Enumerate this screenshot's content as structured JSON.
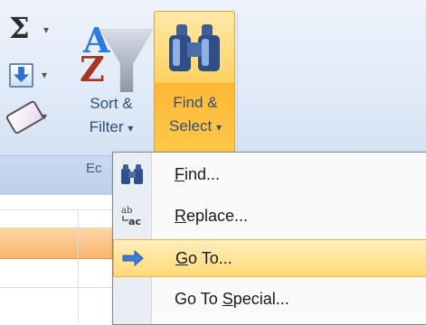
{
  "ribbon": {
    "sort_filter": {
      "line1": "Sort &",
      "line2": "Filter",
      "arrow": "▾"
    },
    "find_select": {
      "line1": "Find &",
      "line2": "Select",
      "arrow": "▾"
    },
    "group_label": "Ec",
    "icons": [
      "autosum-icon",
      "fill-icon",
      "clear-icon",
      "sort-filter-icon",
      "binoculars-icon"
    ],
    "accent": "#ffc84a"
  },
  "menu": {
    "items": [
      {
        "name": "find",
        "icon": "binoculars-icon",
        "mnemonic": "F",
        "rest": "ind..."
      },
      {
        "name": "replace",
        "icon": "replace-icon",
        "mnemonic": "R",
        "rest": "eplace..."
      },
      {
        "name": "go-to",
        "icon": "arrow-right-icon",
        "mnemonic": "G",
        "rest": "o To...",
        "highlighted": true
      },
      {
        "name": "go-to-special",
        "icon": "none",
        "prefix": "Go To ",
        "mnemonic": "S",
        "rest": "pecial..."
      }
    ]
  }
}
